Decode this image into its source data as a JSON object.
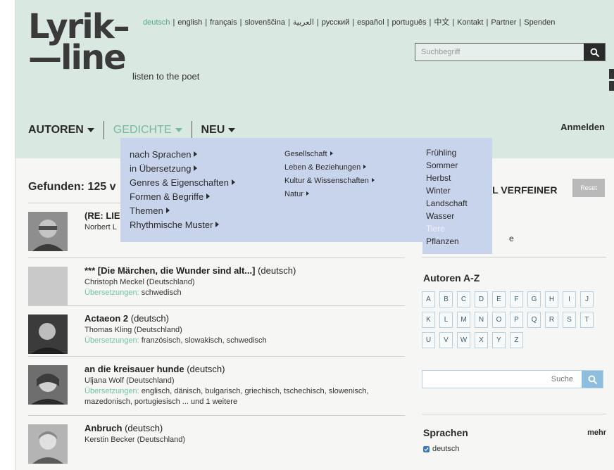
{
  "header": {
    "logo_line1": "Lyrik–",
    "logo_line2": "—line",
    "tagline": "listen to the poet",
    "languages": [
      "deutsch",
      "english",
      "français",
      "slovenščina",
      "العربية",
      "русский",
      "español",
      "português",
      "中文",
      "Kontakt",
      "Partner",
      "Spenden"
    ],
    "active_language": "deutsch",
    "search": {
      "placeholder": "Suchbegriff"
    }
  },
  "nav": {
    "items": [
      {
        "label": "AUTOREN",
        "active": false
      },
      {
        "label": "GEDICHTE",
        "active": true
      },
      {
        "label": "NEU",
        "active": false
      }
    ],
    "login": "Anmelden"
  },
  "dropdown": {
    "col1": [
      "nach Sprachen",
      "in Übersetzung",
      "Genres & Eigenschaften",
      "Formen & Begriffe",
      "Themen",
      "Rhythmische Muster"
    ],
    "col2": [
      "Gesellschaft",
      "Leben & Beziehungen",
      "Kultur & Wissenschaften",
      "Natur"
    ],
    "col3": [
      "Frühling",
      "Sommer",
      "Herbst",
      "Winter",
      "Landschaft",
      "Wasser",
      "Tiere",
      "Pflanzen"
    ],
    "col3_muted": "Tiere"
  },
  "results": {
    "found_label": "Gefunden: 125 v",
    "translations_label": "Übersetzungen:",
    "poems": [
      {
        "title": "(RE: LIE",
        "lang": "",
        "author": "Norbert L",
        "translations": ""
      },
      {
        "title": "*** [Die Märchen, die Wunder sind alt...]",
        "lang": " (deutsch)",
        "author": "Christoph Meckel (Deutschland)",
        "translations": "schwedisch"
      },
      {
        "title": "Actaeon 2",
        "lang": " (deutsch)",
        "author": "Thomas Kling (Deutschland)",
        "translations": "französisch, slowakisch, schwedisch"
      },
      {
        "title": "an die kreisauer hunde",
        "lang": " (deutsch)",
        "author": "Uljana Wolf (Deutschland)",
        "translations": "englisch, dänisch, bulgarisch, griechisch, tschechisch, slowenisch, mazedonisch, portugiesisch ... und 1 weitere"
      },
      {
        "title": "Anbruch",
        "lang": " (deutsch)",
        "author": "Kerstin Becker (Deutschland)",
        "translations": ""
      }
    ]
  },
  "sidebar": {
    "refine_title": "HL VERFEINER",
    "reset": "Reset",
    "fragment": "e",
    "az_title": "Autoren A-Z",
    "letters": [
      "A",
      "B",
      "C",
      "D",
      "E",
      "F",
      "G",
      "H",
      "I",
      "J",
      "K",
      "L",
      "M",
      "N",
      "O",
      "P",
      "Q",
      "R",
      "S",
      "T",
      "U",
      "V",
      "W",
      "X",
      "Y",
      "Z"
    ],
    "author_search_placeholder": "Suche",
    "lang_title": "Sprachen",
    "lang_more": "mehr",
    "lang_option": "deutsch"
  }
}
